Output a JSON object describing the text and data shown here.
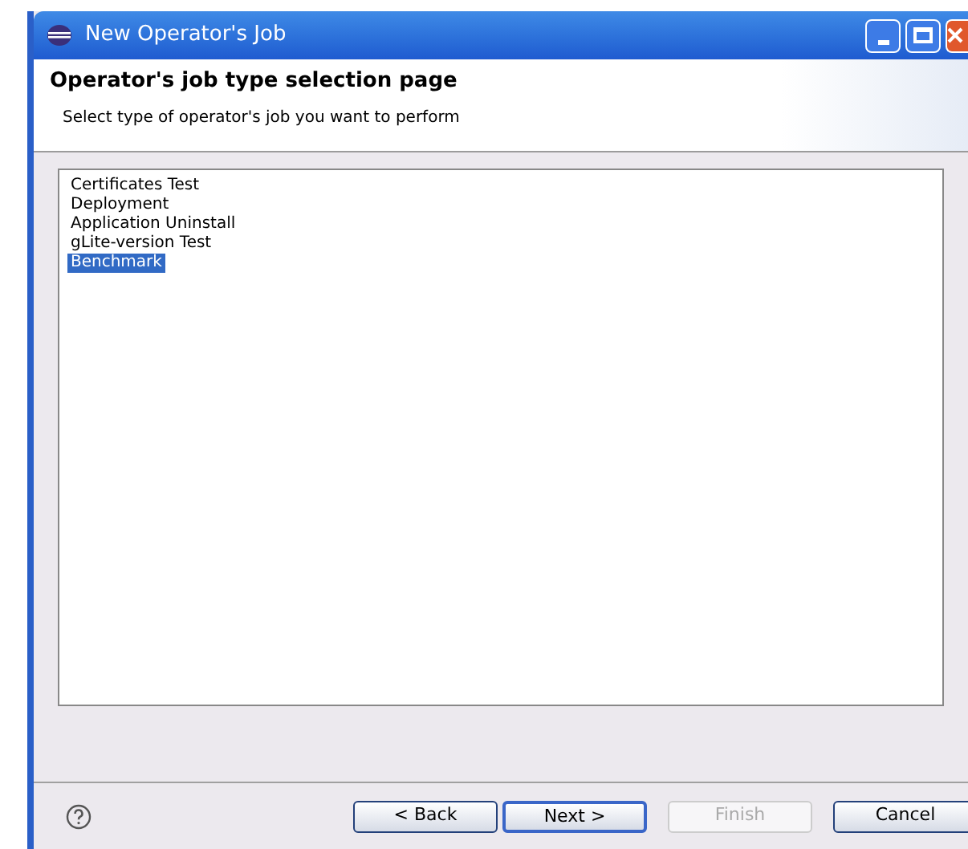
{
  "window": {
    "title": "New Operator's Job"
  },
  "header": {
    "title": "Operator's job type selection page",
    "description": "Select type of operator's job you want to perform"
  },
  "job_types": [
    {
      "label": "Certificates Test",
      "selected": false
    },
    {
      "label": "Deployment",
      "selected": false
    },
    {
      "label": "Application Uninstall",
      "selected": false
    },
    {
      "label": "gLite-version Test",
      "selected": false
    },
    {
      "label": "Benchmark",
      "selected": true
    }
  ],
  "buttons": [
    {
      "label": "< Back",
      "disabled": false,
      "default": false
    },
    {
      "label": "Next >",
      "disabled": false,
      "default": true
    },
    {
      "label": "Finish",
      "disabled": true,
      "default": false
    },
    {
      "label": "Cancel",
      "disabled": false,
      "default": false
    }
  ]
}
